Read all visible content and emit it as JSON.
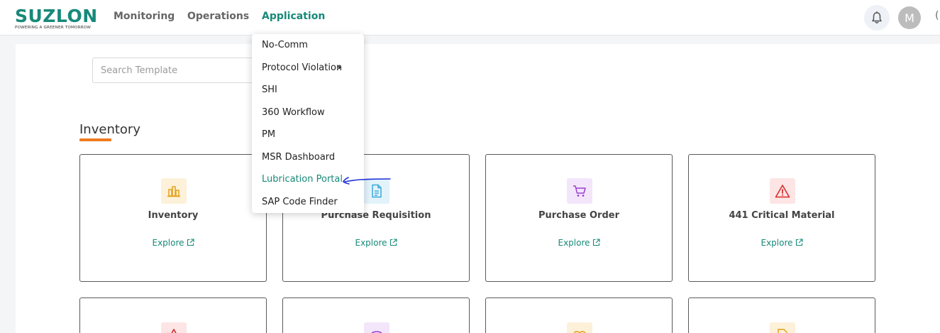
{
  "header": {
    "brand": "SUZLON",
    "tagline": "POWERING A GREENER TOMORROW",
    "nav": [
      {
        "label": "Monitoring",
        "active": false
      },
      {
        "label": "Operations",
        "active": false
      },
      {
        "label": "Application",
        "active": true
      }
    ],
    "avatar_initial": "M",
    "edge_glyph": "(",
    "accent_color": "#17897a"
  },
  "search": {
    "placeholder": "Search Template",
    "value": ""
  },
  "section": {
    "title": "Inventory",
    "underline_color": "#ef7b22"
  },
  "cards": [
    {
      "title": "Inventory",
      "explore": "Explore",
      "icon": "bar-chart-icon",
      "icon_bg": "#fdf1d9",
      "icon_color": "#e4a11b"
    },
    {
      "title": "Purchase Requisition",
      "explore": "Explore",
      "icon": "document-icon",
      "icon_bg": "#e3f3fb",
      "icon_color": "#3aa7d8"
    },
    {
      "title": "Purchase Order",
      "explore": "Explore",
      "icon": "cart-icon",
      "icon_bg": "#f3e6fb",
      "icon_color": "#9b3fd0"
    },
    {
      "title": "441 Critical Material",
      "explore": "Explore",
      "icon": "warning-icon",
      "icon_bg": "#fde5e5",
      "icon_color": "#d62c2c"
    }
  ],
  "dropdown": {
    "items": [
      {
        "label": "No-Comm",
        "has_submenu": false,
        "active": false
      },
      {
        "label": "Protocol Violation",
        "has_submenu": true,
        "active": false
      },
      {
        "label": "SHI",
        "has_submenu": false,
        "active": false
      },
      {
        "label": "360 Workflow",
        "has_submenu": false,
        "active": false
      },
      {
        "label": "PM",
        "has_submenu": false,
        "active": false
      },
      {
        "label": "MSR Dashboard",
        "has_submenu": false,
        "active": false
      },
      {
        "label": "Lubrication Portal",
        "has_submenu": false,
        "active": true
      },
      {
        "label": "SAP Code Finder",
        "has_submenu": false,
        "active": false
      }
    ]
  }
}
